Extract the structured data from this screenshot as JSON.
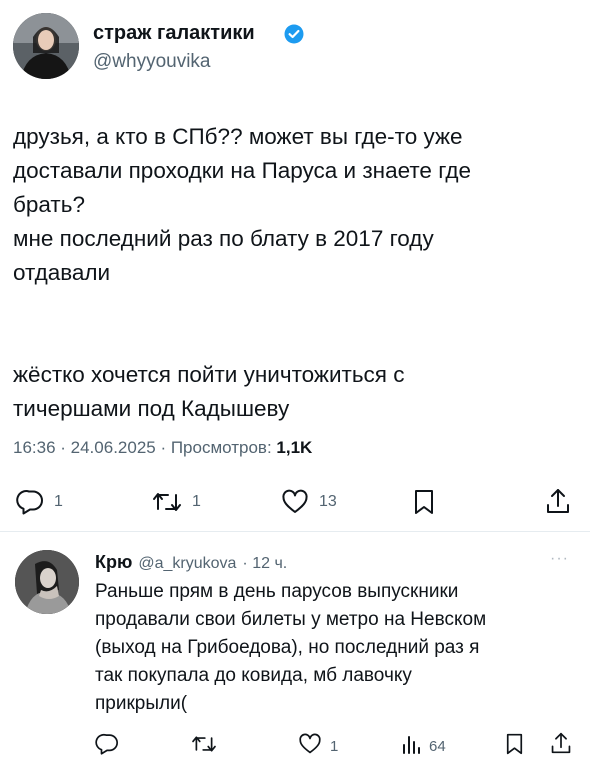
{
  "tweet": {
    "display_name": "страж галактики",
    "handle": "@whyyouvika",
    "text": "друзья, а кто в СПб?? может вы где-то уже\nдоставали проходки на Паруса и знаете где\nбрать?\nмне последний раз по блату в 2017 году\nотдавали\n\n\nжёстко хочется пойти уничтожиться с\nтичершами под Кадышеву",
    "timestamp": "16:36 · 24.06.2025 · Просмотров: ",
    "views": "1,1K",
    "replies": "1",
    "retweets": "1",
    "likes": "13"
  },
  "reply": {
    "display_name": "Крю",
    "handle": "@a_kryukova",
    "time": "· 12 ч.",
    "more": "···",
    "text": "Раньше прям в день парусов выпускники\nпродавали свои билеты у метро на Невском\n(выход на Грибоедова), но последний раз я\nтак покупала до ковида, мб лавочку\nприкрыли(",
    "likes": "1",
    "views": "64"
  },
  "colors": {
    "verified": "#1d9bf0",
    "muted": "#536471",
    "text": "#0f1419"
  }
}
